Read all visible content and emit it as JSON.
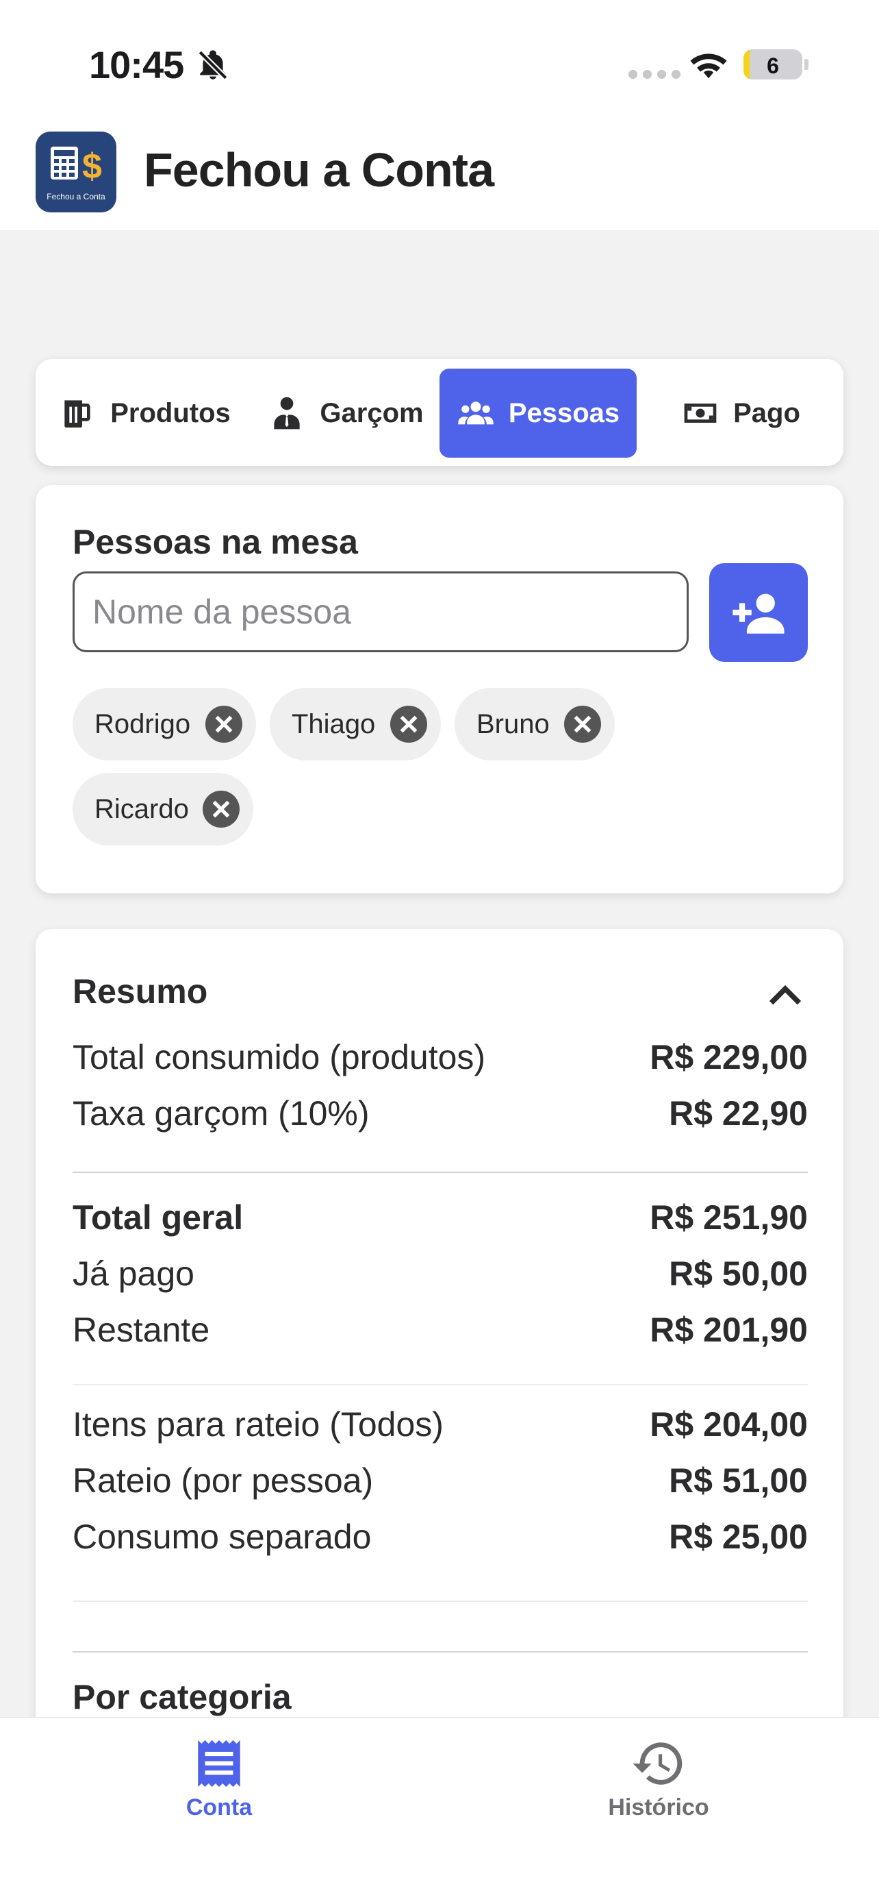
{
  "status": {
    "time": "10:45",
    "battery": "6",
    "battery_level": 0.06
  },
  "app": {
    "title": "Fechou a Conta",
    "logo_text": "Fechou a Conta"
  },
  "tabs": [
    {
      "label": "Produtos",
      "icon": "beer-mug-icon"
    },
    {
      "label": "Garçom",
      "icon": "waiter-icon"
    },
    {
      "label": "Pessoas",
      "icon": "group-icon",
      "active": true
    },
    {
      "label": "Pago",
      "icon": "money-icon"
    }
  ],
  "people": {
    "title": "Pessoas na mesa",
    "input_placeholder": "Nome da pessoa",
    "input_value": "",
    "list": [
      "Rodrigo",
      "Thiago",
      "Bruno",
      "Ricardo"
    ]
  },
  "summary": {
    "title": "Resumo",
    "rows": [
      {
        "label": "Total consumido (produtos)",
        "value": "R$ 229,00"
      },
      {
        "label": "Taxa garçom (10%)",
        "value": "R$ 22,90"
      },
      {
        "label": "Total geral",
        "value": "R$ 251,90"
      },
      {
        "label": "Já pago",
        "value": "R$ 50,00"
      },
      {
        "label": "Restante",
        "value": "R$ 201,90"
      },
      {
        "label": "Itens para rateio (Todos)",
        "value": "R$ 204,00"
      },
      {
        "label": "Rateio (por pessoa)",
        "value": "R$ 51,00"
      },
      {
        "label": "Consumo separado",
        "value": "R$ 25,00"
      }
    ],
    "category_title": "Por categoria"
  },
  "nav": [
    {
      "label": "Conta",
      "icon": "receipt-icon",
      "active": true
    },
    {
      "label": "Histórico",
      "icon": "history-icon",
      "active": false
    }
  ],
  "colors": {
    "accent": "#4f63ea",
    "brand": "#27457a",
    "gold": "#f2b233",
    "inactive": "#6e6e73"
  }
}
